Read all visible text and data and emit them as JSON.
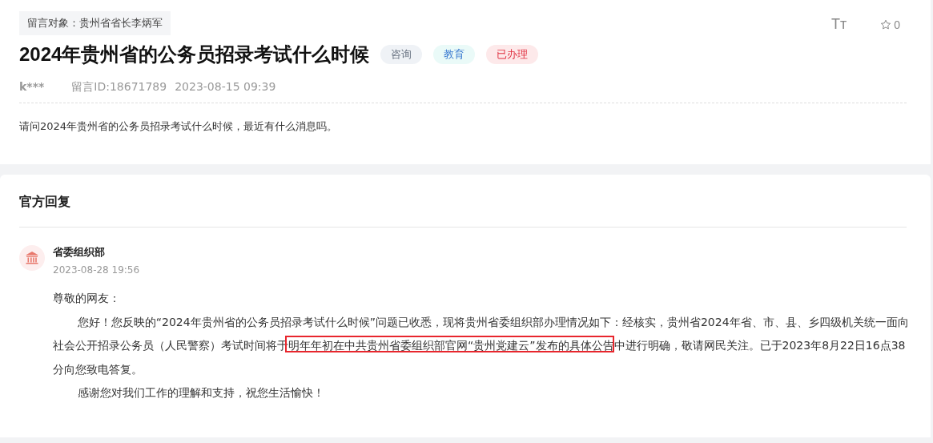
{
  "message": {
    "recipient": "留言对象：贵州省省长李炳军",
    "title": "2024年贵州省的公务员招录考试什么时候",
    "tags": [
      {
        "label": "咨询",
        "kind": "type"
      },
      {
        "label": "教育",
        "kind": "field"
      },
      {
        "label": "已办理",
        "kind": "status"
      }
    ],
    "author": "k***",
    "message_id": "留言ID:18671789",
    "time": "2023-08-15 09:39",
    "font_size_button": "Tт",
    "favorite_count": "0",
    "body": "请问2024年贵州省的公务员招录考试什么时候，最近有什么消息吗。"
  },
  "reply": {
    "heading": "官方回复",
    "department": "省委组织部",
    "time": "2023-08-28 19:56",
    "paragraphs": [
      {
        "indent": false,
        "segments": [
          {
            "text": "尊敬的网友：",
            "highlighted": false
          }
        ]
      },
      {
        "indent": true,
        "segments": [
          {
            "text": "您好！您反映的“2024年贵州省的公务员招录考试什么时候”问题已收悉，现将贵州省委组织部办理情况如下：经核实，贵州省2024年省、市、县、乡四级机关统一面向社会公开招录公务员（人民警察）考试时间将于",
            "highlighted": false
          },
          {
            "text": "明年年初在中共贵州省委组织部官网“贵州党建云”发布的具体公告",
            "highlighted": true
          },
          {
            "text": "中进行明确，敬请网民关注。已于2023年8月22日16点38分向您致电答复。",
            "highlighted": false
          }
        ]
      },
      {
        "indent": true,
        "segments": [
          {
            "text": "感谢您对我们工作的理解和支持，祝您生活愉快！",
            "highlighted": false
          }
        ]
      }
    ]
  }
}
